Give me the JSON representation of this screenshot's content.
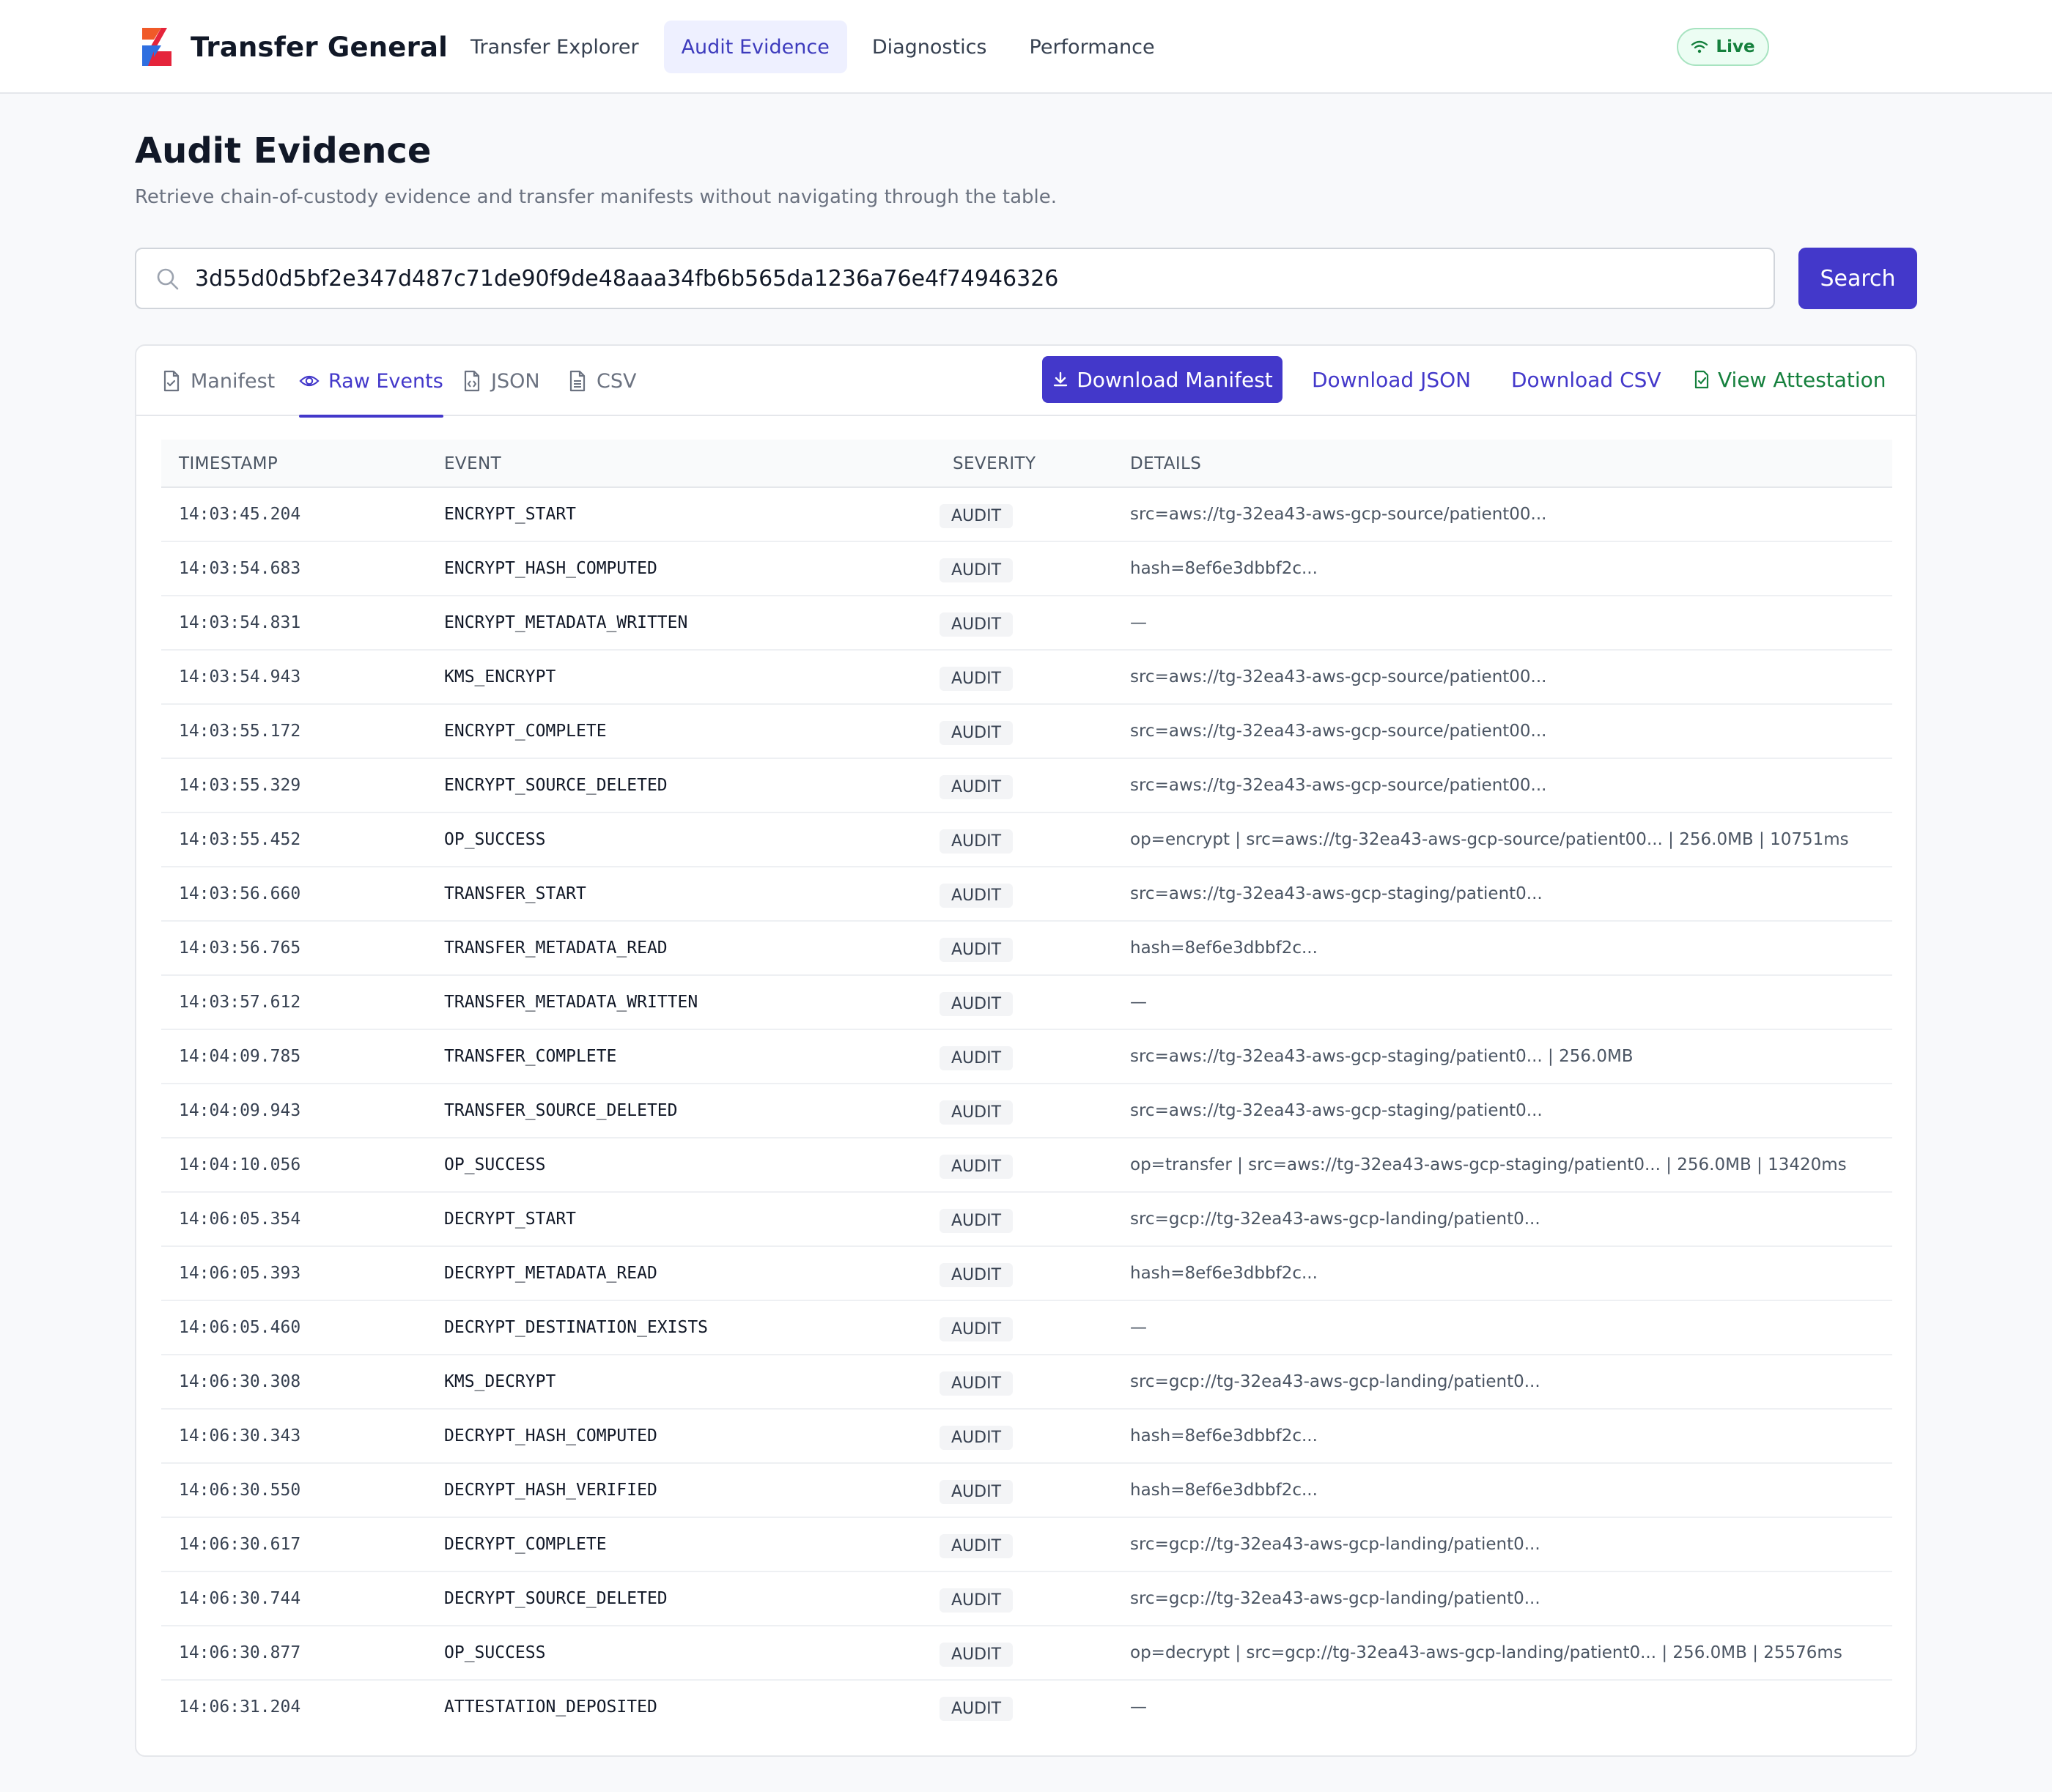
{
  "app": {
    "name": "Transfer General",
    "nav": [
      {
        "label": "Transfer Explorer",
        "active": false
      },
      {
        "label": "Audit Evidence",
        "active": true
      },
      {
        "label": "Diagnostics",
        "active": false
      },
      {
        "label": "Performance",
        "active": false
      }
    ],
    "live_label": "Live"
  },
  "page": {
    "title": "Audit Evidence",
    "subtitle": "Retrieve chain-of-custody evidence and transfer manifests without navigating through the table."
  },
  "search": {
    "value": "3d55d0d5bf2e347d487c71de90f9de48aaa34fb6b565da1236a76e4f74946326",
    "button_label": "Search"
  },
  "tabs": [
    {
      "label": "Manifest",
      "icon": "file-icon",
      "active": false
    },
    {
      "label": "Raw Events",
      "icon": "eye-icon",
      "active": true
    },
    {
      "label": "JSON",
      "icon": "file-code-icon",
      "active": false
    },
    {
      "label": "CSV",
      "icon": "file-csv-icon",
      "active": false
    }
  ],
  "actions": {
    "download_manifest": "Download Manifest",
    "download_json": "Download JSON",
    "download_csv": "Download CSV",
    "view_attestation": "View Attestation"
  },
  "table": {
    "columns": [
      "TIMESTAMP",
      "EVENT",
      "SEVERITY",
      "DETAILS"
    ],
    "rows": [
      {
        "ts": "14:03:45.204",
        "event": "ENCRYPT_START",
        "severity": "AUDIT",
        "details": "src=aws://tg-32ea43-aws-gcp-source/patient00..."
      },
      {
        "ts": "14:03:54.683",
        "event": "ENCRYPT_HASH_COMPUTED",
        "severity": "AUDIT",
        "details": "hash=8ef6e3dbbf2c..."
      },
      {
        "ts": "14:03:54.831",
        "event": "ENCRYPT_METADATA_WRITTEN",
        "severity": "AUDIT",
        "details": "—"
      },
      {
        "ts": "14:03:54.943",
        "event": "KMS_ENCRYPT",
        "severity": "AUDIT",
        "details": "src=aws://tg-32ea43-aws-gcp-source/patient00..."
      },
      {
        "ts": "14:03:55.172",
        "event": "ENCRYPT_COMPLETE",
        "severity": "AUDIT",
        "details": "src=aws://tg-32ea43-aws-gcp-source/patient00..."
      },
      {
        "ts": "14:03:55.329",
        "event": "ENCRYPT_SOURCE_DELETED",
        "severity": "AUDIT",
        "details": "src=aws://tg-32ea43-aws-gcp-source/patient00..."
      },
      {
        "ts": "14:03:55.452",
        "event": "OP_SUCCESS",
        "severity": "AUDIT",
        "details": "op=encrypt | src=aws://tg-32ea43-aws-gcp-source/patient00... | 256.0MB | 10751ms"
      },
      {
        "ts": "14:03:56.660",
        "event": "TRANSFER_START",
        "severity": "AUDIT",
        "details": "src=aws://tg-32ea43-aws-gcp-staging/patient0..."
      },
      {
        "ts": "14:03:56.765",
        "event": "TRANSFER_METADATA_READ",
        "severity": "AUDIT",
        "details": "hash=8ef6e3dbbf2c..."
      },
      {
        "ts": "14:03:57.612",
        "event": "TRANSFER_METADATA_WRITTEN",
        "severity": "AUDIT",
        "details": "—"
      },
      {
        "ts": "14:04:09.785",
        "event": "TRANSFER_COMPLETE",
        "severity": "AUDIT",
        "details": "src=aws://tg-32ea43-aws-gcp-staging/patient0... | 256.0MB"
      },
      {
        "ts": "14:04:09.943",
        "event": "TRANSFER_SOURCE_DELETED",
        "severity": "AUDIT",
        "details": "src=aws://tg-32ea43-aws-gcp-staging/patient0..."
      },
      {
        "ts": "14:04:10.056",
        "event": "OP_SUCCESS",
        "severity": "AUDIT",
        "details": "op=transfer | src=aws://tg-32ea43-aws-gcp-staging/patient0... | 256.0MB | 13420ms"
      },
      {
        "ts": "14:06:05.354",
        "event": "DECRYPT_START",
        "severity": "AUDIT",
        "details": "src=gcp://tg-32ea43-aws-gcp-landing/patient0..."
      },
      {
        "ts": "14:06:05.393",
        "event": "DECRYPT_METADATA_READ",
        "severity": "AUDIT",
        "details": "hash=8ef6e3dbbf2c..."
      },
      {
        "ts": "14:06:05.460",
        "event": "DECRYPT_DESTINATION_EXISTS",
        "severity": "AUDIT",
        "details": "—"
      },
      {
        "ts": "14:06:30.308",
        "event": "KMS_DECRYPT",
        "severity": "AUDIT",
        "details": "src=gcp://tg-32ea43-aws-gcp-landing/patient0..."
      },
      {
        "ts": "14:06:30.343",
        "event": "DECRYPT_HASH_COMPUTED",
        "severity": "AUDIT",
        "details": "hash=8ef6e3dbbf2c..."
      },
      {
        "ts": "14:06:30.550",
        "event": "DECRYPT_HASH_VERIFIED",
        "severity": "AUDIT",
        "details": "hash=8ef6e3dbbf2c..."
      },
      {
        "ts": "14:06:30.617",
        "event": "DECRYPT_COMPLETE",
        "severity": "AUDIT",
        "details": "src=gcp://tg-32ea43-aws-gcp-landing/patient0..."
      },
      {
        "ts": "14:06:30.744",
        "event": "DECRYPT_SOURCE_DELETED",
        "severity": "AUDIT",
        "details": "src=gcp://tg-32ea43-aws-gcp-landing/patient0..."
      },
      {
        "ts": "14:06:30.877",
        "event": "OP_SUCCESS",
        "severity": "AUDIT",
        "details": "op=decrypt | src=gcp://tg-32ea43-aws-gcp-landing/patient0... | 256.0MB | 25576ms"
      },
      {
        "ts": "14:06:31.204",
        "event": "ATTESTATION_DEPOSITED",
        "severity": "AUDIT",
        "details": "—"
      }
    ]
  },
  "colors": {
    "accent": "#4338ca",
    "live_green": "#15803d",
    "logo_orange": "#f05a28",
    "logo_red": "#e5243b",
    "logo_blue": "#2f6fe0"
  }
}
